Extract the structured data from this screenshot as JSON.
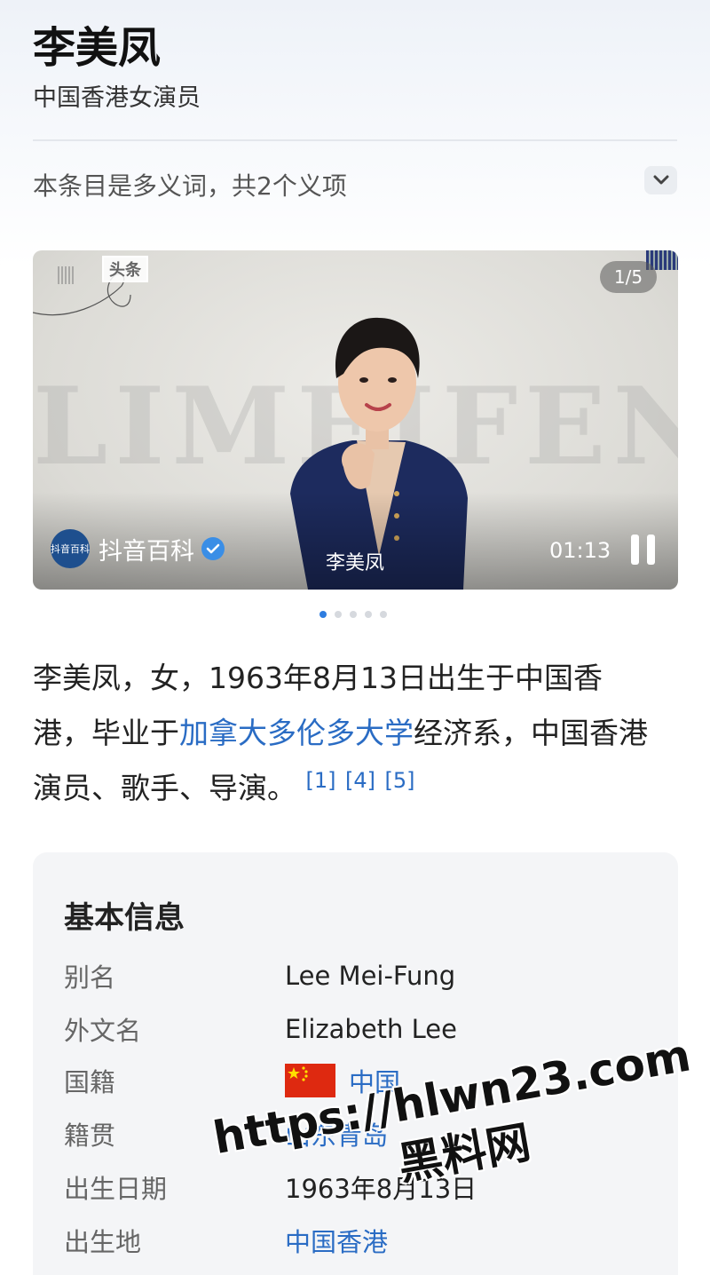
{
  "header": {
    "title": "李美凤",
    "subtitle": "中国香港女演员"
  },
  "disambiguation": {
    "text": "本条目是多义词，共2个义项",
    "icon": "chevron-down-icon"
  },
  "video": {
    "watermark_badge": "头条",
    "counter": "1/5",
    "background_letters": "LIMEIFENG",
    "channel_name": "抖音百科",
    "channel_logo_text": "抖音百科",
    "caption": "李美凤",
    "time": "01:13",
    "pause_icon": "pause-icon",
    "verified_icon": "verified-check-icon"
  },
  "carousel": {
    "total": 5,
    "active_index": 0
  },
  "intro": {
    "part1": "李美凤，女，1963年8月13日出生于中国香港，毕业于",
    "link": "加拿大多伦多大学",
    "part2": "经济系，中国香港演员、歌手、导演。",
    "refs": [
      "[1]",
      "[4]",
      "[5]"
    ]
  },
  "infobox": {
    "title": "基本信息",
    "rows": [
      {
        "label": "别名",
        "value": "Lee Mei-Fung"
      },
      {
        "label": "外文名",
        "value": "Elizabeth Lee"
      },
      {
        "label": "国籍",
        "value": "中国"
      },
      {
        "label": "籍贯",
        "value": "山东青岛"
      },
      {
        "label": "出生日期",
        "value": "1963年8月13日"
      },
      {
        "label": "出生地",
        "value": "中国香港"
      }
    ]
  },
  "overlay_watermark": {
    "line1": "https://hlwn23.com",
    "line2": "黑料网"
  },
  "colors": {
    "link": "#2a6cc4",
    "active_dot": "#2e7de0",
    "flag_red": "#de2910"
  }
}
